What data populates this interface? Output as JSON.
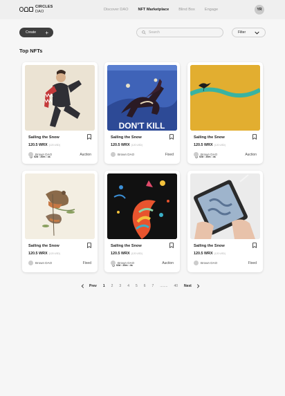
{
  "header": {
    "logo_line1": "CIRCLES",
    "logo_line2": "DAO",
    "nav": [
      {
        "label": "Discover DAO",
        "active": false
      },
      {
        "label": "NFT Marketplace",
        "active": true
      },
      {
        "label": "Blind Box",
        "active": false
      },
      {
        "label": "Engage",
        "active": false
      }
    ],
    "avatar_initials": "YR"
  },
  "toolbar": {
    "create_label": "Create",
    "create_icon": "plus-icon",
    "search_placeholder": "Search",
    "filter_label": "Filter"
  },
  "section_title": "Top NFTs",
  "cards": [
    {
      "title": "Sailing the Snow",
      "price": "120.5 WRX",
      "usd": "(120 USD)",
      "owner": "Brown DAO",
      "sale_type": "Auction",
      "timer": "02d : 20m : 4s",
      "has_timer": true
    },
    {
      "title": "Sailing the Snow",
      "price": "120.5 WRX",
      "usd": "(120 USD)",
      "owner": "Brown DAO",
      "sale_type": "Fixed",
      "timer": "",
      "has_timer": false,
      "poster_text": "DON'T KILL"
    },
    {
      "title": "Sailing the Snow",
      "price": "120.5 WRX",
      "usd": "(120 USD)",
      "owner": "Brown DAO",
      "sale_type": "Auction",
      "timer": "02d : 20m : 4s",
      "has_timer": true
    },
    {
      "title": "Sailing the Snow",
      "price": "120.5 WRX",
      "usd": "(120 USD)",
      "owner": "Brown DAO",
      "sale_type": "Fixed",
      "timer": "",
      "has_timer": false
    },
    {
      "title": "Sailing the Snow",
      "price": "120.5 WRX",
      "usd": "(120 USD)",
      "owner": "Brown DAO",
      "sale_type": "Auction",
      "timer": "02d : 20m : 4s",
      "has_timer": true
    },
    {
      "title": "Sailing the Snow",
      "price": "120.5 WRX",
      "usd": "(120 USD)",
      "owner": "Brown DAO",
      "sale_type": "Fixed",
      "timer": "",
      "has_timer": false
    }
  ],
  "pagination": {
    "prev_label": "Prev",
    "next_label": "Next",
    "pages": [
      "1",
      "2",
      "3",
      "4",
      "5",
      "6",
      "7"
    ],
    "current": "1",
    "ellipsis": "........",
    "last": "40"
  },
  "colors": {
    "button_dark": "#3f3f3f",
    "page_bg": "#f6f6f6",
    "header_bg": "#efefef"
  }
}
